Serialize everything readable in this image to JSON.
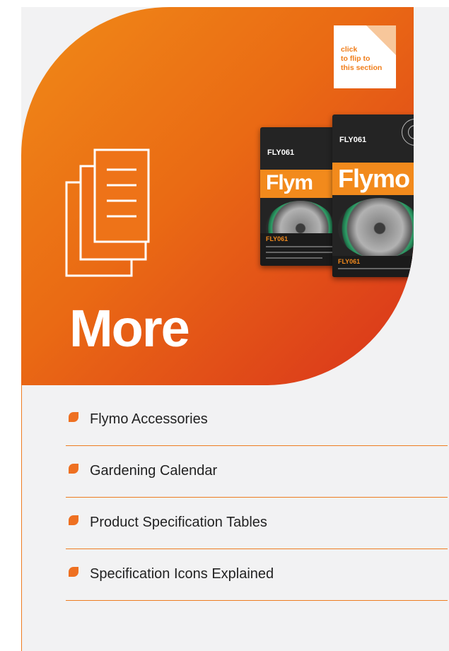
{
  "flip_tag": {
    "text": "click\nto flip to\nthis section"
  },
  "section": {
    "title": "More"
  },
  "product": {
    "code": "FLY061",
    "brand": "Flymo",
    "back_brand": "Flym",
    "subtitle": "FLY061"
  },
  "menu": {
    "items": [
      {
        "label": "Flymo Accessories"
      },
      {
        "label": "Gardening Calendar"
      },
      {
        "label": "Product Specification Tables"
      },
      {
        "label": "Specification Icons Explained"
      }
    ]
  },
  "colors": {
    "accent": "#ee7021",
    "hero_start": "#f08a17",
    "hero_end": "#d9331c",
    "page_bg": "#f2f2f3"
  }
}
